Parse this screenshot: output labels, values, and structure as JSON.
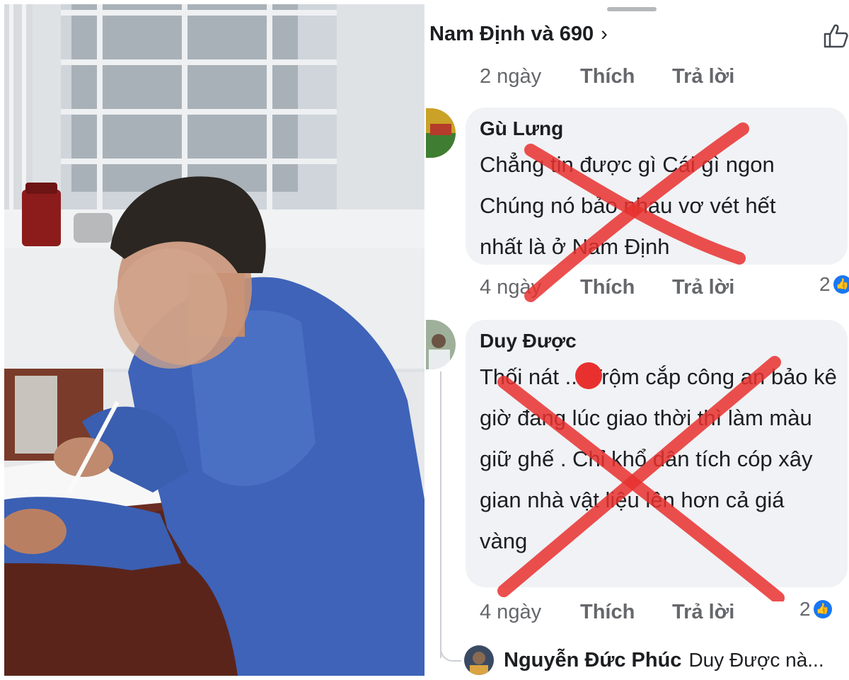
{
  "photo": {
    "icon": "person-writing-photo"
  },
  "header": {
    "reactors_text": "Nam Định và 690",
    "chevron": "›",
    "like_icon": "thumbs-up-outline-icon"
  },
  "top_meta": {
    "time": "2 ngày",
    "like": "Thích",
    "reply": "Trả lời"
  },
  "comments": [
    {
      "author": "Gù Lưng",
      "text": "Chẳng tin được gì Cái gì ngon Chúng nó bảo nhau vơ vét hết nhất là ở Nam Định",
      "time": "4 ngày",
      "like": "Thích",
      "reply": "Trả lời",
      "reactions": "2"
    },
    {
      "author": "Duy Được",
      "text": "Thối nát ... Trộm cắp công an bảo kê giờ đang lúc giao thời thì làm màu giữ ghế . Chỉ khổ dân tích cóp xây gian nhà vật liệu lên hơn cả giá vàng",
      "time": "4 ngày",
      "like": "Thích",
      "reply": "Trả lời",
      "reactions": "2"
    }
  ],
  "reply_preview": {
    "author": "Nguyễn Đức Phúc",
    "text": "Duy Được nà..."
  },
  "colors": {
    "cross_mark": "#e8312f",
    "bubble": "#f0f2f5",
    "like_blue": "#1877f2",
    "shirt": "#3e63b8"
  }
}
